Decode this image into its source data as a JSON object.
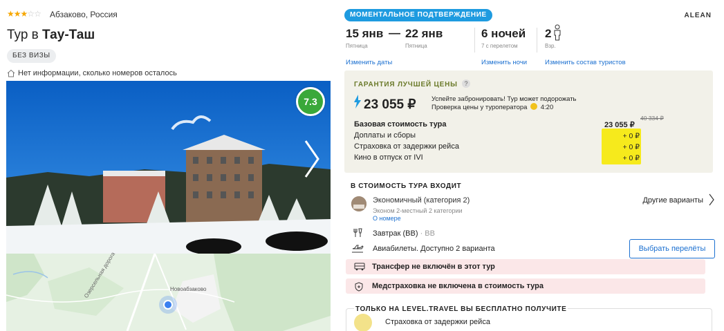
{
  "hotel": {
    "stars": 3,
    "stars_max": 5,
    "location": "Абзаково, Россия",
    "title_prefix": "Тур в",
    "title_name": "Тау-Таш",
    "visa_badge": "БЕЗ ВИЗЫ",
    "rooms_info": "Нет информации, сколько номеров осталось",
    "rating": "7.3"
  },
  "map": {
    "town_label": "Новоабзаково",
    "road_label": "Озерсельная дорога"
  },
  "tour": {
    "instant_badge": "МОМЕНТАЛЬНОЕ ПОДТВЕРЖДЕНИЕ",
    "operator": "ALEAN",
    "date_from": "15 янв",
    "date_from_day": "Пятница",
    "date_sep": "—",
    "date_to": "22 янв",
    "date_to_day": "Пятница",
    "nights": "6 ночей",
    "nights_sub": "7 с перелетом",
    "adults": "2",
    "adults_sub": "Взр.",
    "change_dates": "Изменить даты",
    "change_nights": "Изменить ночи",
    "change_tourists": "Изменить состав туристов"
  },
  "price": {
    "guarantee_title": "ГАРАНТИЯ ЛУЧШЕЙ ЦЕНЫ",
    "question": "?",
    "total": "23 055 ₽",
    "hurry_line1": "Успейте забронировать! Тур может подорожать",
    "hurry_line2_prefix": "Проверка цены у туроператора",
    "hurry_time": "4:20",
    "base_label": "Базовая стоимость тура",
    "base_value": "23 055 ₽",
    "base_old": "40 334 ₽",
    "fees_label": "Доплаты и сборы",
    "fees_value": "+ 0 ₽",
    "insurance_label": "Страховка от задержки рейса",
    "insurance_value": "+ 0 ₽",
    "cinema_label": "Кино в отпуск от IVI",
    "cinema_value": "+ 0 ₽"
  },
  "included": {
    "title": "В СТОИМОСТЬ ТУРА ВХОДИТ",
    "room_name": "Экономичный (категория 2)",
    "room_sub": "Эконом 2-местный 2 категории",
    "room_link": "О номере",
    "other_variants": "Другие варианты",
    "meal": "Завтрак (BB)",
    "meal_code": "· BB",
    "flights": "Авиабилеты. Доступно 2 варианта",
    "choose_flights": "Выбрать перелёты",
    "transfer_warn": "Трансфер не включён в этот тур",
    "medical_warn": "Медстраховка не включена в стоимость тура"
  },
  "free": {
    "title": "ТОЛЬКО НА LEVEL.TRAVEL ВЫ БЕСПЛАТНО ПОЛУЧИТЕ",
    "item1": "Страховка от задержки рейса"
  },
  "colors": {
    "accent_blue": "#1a6fd0",
    "badge_blue": "#1e9be0",
    "rating_green": "#3aa83a",
    "highlight_yellow": "#f6ea1c",
    "warn_pink": "#fbe7e8",
    "price_box": "#f2f1e9"
  }
}
